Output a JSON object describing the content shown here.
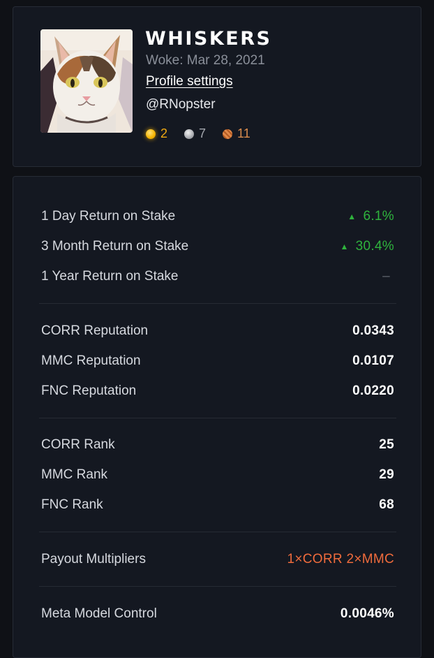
{
  "profile": {
    "username": "WHISKERS",
    "woke": "Woke: Mar 28, 2021",
    "settings_label": "Profile settings",
    "handle": "@RNopster",
    "medals": {
      "gold": "2",
      "silver": "7",
      "bronze": "11"
    }
  },
  "returns": [
    {
      "label": "1 Day Return on Stake",
      "value": "6.1%",
      "arrow": "▲"
    },
    {
      "label": "3 Month Return on Stake",
      "value": "30.4%",
      "arrow": "▲"
    },
    {
      "label": "1 Year Return on Stake",
      "value": "–"
    }
  ],
  "reputation": [
    {
      "label": "CORR Reputation",
      "value": "0.0343"
    },
    {
      "label": "MMC Reputation",
      "value": "0.0107"
    },
    {
      "label": "FNC Reputation",
      "value": "0.0220"
    }
  ],
  "ranks": [
    {
      "label": "CORR Rank",
      "value": "25"
    },
    {
      "label": "MMC Rank",
      "value": "29"
    },
    {
      "label": "FNC Rank",
      "value": "68"
    }
  ],
  "payout": {
    "label": "Payout Multipliers",
    "value": "1×CORR 2×MMC"
  },
  "meta": {
    "label": "Meta Model Control",
    "value": "0.0046%"
  },
  "colors": {
    "positive": "#2fb33d",
    "accent_orange": "#ef6b3c",
    "gold": "#f0a912",
    "silver": "#a3a6ad",
    "bronze": "#d98b4d"
  }
}
